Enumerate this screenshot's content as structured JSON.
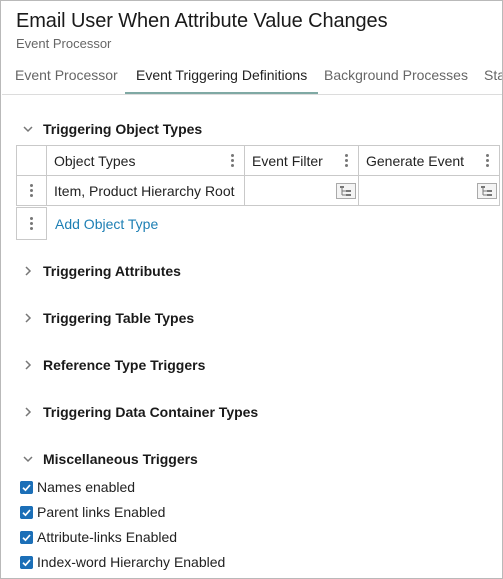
{
  "header": {
    "title": "Email User When Attribute Value Changes",
    "subtitle": "Event Processor"
  },
  "tabs": [
    {
      "label": "Event Processor",
      "active": false
    },
    {
      "label": "Event Triggering Definitions",
      "active": true
    },
    {
      "label": "Background Processes",
      "active": false
    },
    {
      "label": "Sta",
      "active": false
    }
  ],
  "colors": {
    "active_tab_underline": "#7fa9a4",
    "link": "#1d7fb4",
    "checkbox": "#1c6fb7"
  },
  "sections": {
    "object_types": {
      "title": "Triggering Object Types",
      "expanded": true,
      "columns": [
        "Object Types",
        "Event Filter",
        "Generate Event"
      ],
      "rows": [
        {
          "object_types": "Item, Product Hierarchy Root",
          "event_filter": "",
          "generate_event": ""
        }
      ],
      "add_label": "Add Object Type"
    },
    "attributes": {
      "title": "Triggering Attributes",
      "expanded": false
    },
    "table_types": {
      "title": "Triggering Table Types",
      "expanded": false
    },
    "reference_types": {
      "title": "Reference Type Triggers",
      "expanded": false
    },
    "data_container_types": {
      "title": "Triggering Data Container Types",
      "expanded": false
    },
    "misc": {
      "title": "Miscellaneous Triggers",
      "expanded": true,
      "options": [
        {
          "label": "Names enabled",
          "checked": true
        },
        {
          "label": "Parent links Enabled",
          "checked": true
        },
        {
          "label": "Attribute-links Enabled",
          "checked": true
        },
        {
          "label": "Index-word Hierarchy Enabled",
          "checked": true
        }
      ]
    }
  }
}
